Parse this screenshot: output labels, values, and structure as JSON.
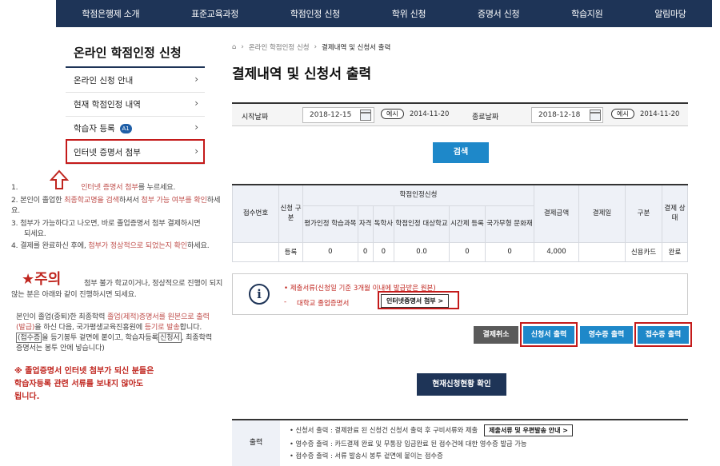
{
  "nav": [
    "학점은행제 소개",
    "표준교육과정",
    "학점인정 신청",
    "학위 신청",
    "증명서 신청",
    "학습지원",
    "알림마당"
  ],
  "sidebar": {
    "title": "온라인 학점인정 신청",
    "items": [
      {
        "label": "온라인 신청 안내"
      },
      {
        "label": "현재 학점인정 내역"
      },
      {
        "label": "학습자 등록",
        "badge": "A1"
      },
      {
        "label": "인터넷 증명서 첨부"
      }
    ]
  },
  "annotation": {
    "steps": [
      {
        "num": "1.",
        "pre": "",
        "hl": "인터넷 증명서 첨부",
        "post": "를 누르세요."
      },
      {
        "num": "2.",
        "pre": "본인이 졸업한 ",
        "hl": "최종학교명을 검색",
        "mid": "하셔서 ",
        "hl2": "첨부 가능 여부를 확인",
        "post": "하세요."
      },
      {
        "num": "3.",
        "text1": "첨부가 가능하다고 나오면, 바로 졸업증명서 첨부 결제하시면",
        "text2": "되세요."
      },
      {
        "num": "4.",
        "pre": "결제를 완료하신 후에, ",
        "hl": "첨부가 정상적으로 되었는지 확인",
        "post": "하세요."
      }
    ],
    "caution_title": "★주의",
    "caution_line1": "첨부 불가 학교이거나, 정상적으로 진행이 되지",
    "caution_line2": "않는 분은 아래와 같이 진행하시면 되세요.",
    "para_a": "본인이 졸업(중퇴)한 최종학력 ",
    "para_hl1": "졸업(제적)증명서를 원본으로 출력",
    "para_b": "(발급)",
    "para_c": "을 하신 다음, 국가평생교육진흥원에 ",
    "para_hl2": "등기로 발송",
    "para_d": "합니다.",
    "para_e": "(접수증",
    "para_f": "을 등기봉투 겉면에 붙이고, 학습자등록",
    "para_g": "신청서",
    "para_h": ", 최종학력",
    "para_i": "증명서는 봉투 안에 넣습니다)",
    "warn1": "※ 졸업증명서 인터넷 첨부가 되신 분들은",
    "warn2": "학습자등록 관련 서류를 보내지 않아도",
    "warn3": "됩니다."
  },
  "breadcrumb": {
    "home": "⌂",
    "parent": "온라인 학점인정 신청",
    "current": "결제내역 및 신청서 출력"
  },
  "page_title": "결제내역 및 신청서 출력",
  "search": {
    "start_label": "시작날짜",
    "start_value": "2018-12-15",
    "end_label": "종료날짜",
    "end_value": "2018-12-18",
    "example_label": "예시",
    "example_date": "2014-11-20",
    "button": "검색"
  },
  "table": {
    "h_receipt": "접수번호",
    "h_apptype": "신청 구분",
    "h_group": "학점인정신청",
    "h_sub": [
      "평가인정 학습과목",
      "자격",
      "독학사",
      "학점인정 대상학교",
      "시간제 등록",
      "국가무형 문화재"
    ],
    "h_amount": "결제금액",
    "h_date": "결제일",
    "h_method": "구분",
    "h_status": "결제 상태",
    "row": {
      "receipt": "",
      "apptype": "등록",
      "c1": "0",
      "c2": "0",
      "c3": "0",
      "c4": "0.0",
      "c5": "0",
      "c6": "0",
      "amount": "4,000",
      "date": "",
      "method": "신용카드",
      "status": "완료"
    }
  },
  "info": {
    "icon": "i",
    "line1": "• 제출서류(신청일 기준 3개월 이내에 발급받은 원본)",
    "line2_dash": "-",
    "line2": "대학교 졸업증명서",
    "attach_button": "인터넷증명서 첨부 >"
  },
  "actions": {
    "cancel": "결제취소",
    "print_app": "신청서 출력",
    "print_receipt": "영수증 출력",
    "print_accept": "접수증 출력"
  },
  "status_button": "현재신청현황 확인",
  "output": {
    "label": "출력",
    "line1": "• 신청서 출력 : 결제완료 된 신청건 신청서 출력 후 구비서류와 제출",
    "line1_button": "제출서류 및 우편발송 안내 >",
    "line2": "• 영수증 출력 : 카드결제 완료 및 무통장 입금완료 된 접수건에 대한 영수증 발급 가능",
    "line3": "• 접수증 출력 : 서류 발송시 봉투 겉면에 붙이는 접수증"
  },
  "colors": {
    "navy": "#1e3457",
    "blue": "#1e88c9",
    "red": "#c41a1a",
    "highlight": "#c0504d"
  }
}
